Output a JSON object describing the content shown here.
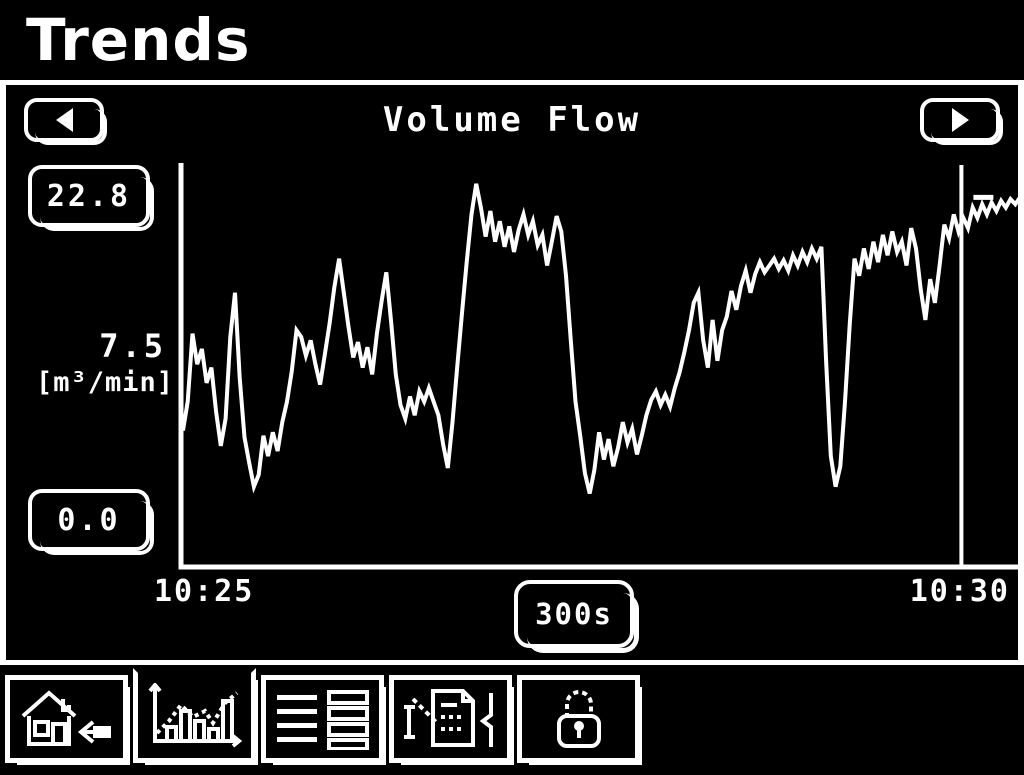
{
  "header": {
    "title": "Trends"
  },
  "chart_panel": {
    "title": "Volume Flow",
    "prev_button": "prev-channel",
    "next_button": "next-channel",
    "scale_max": "22.8",
    "scale_min": "0.0",
    "current_value": "7.5",
    "unit": "[m³/min]",
    "time_start": "10:25",
    "time_end": "10:30",
    "timespan": "300s"
  },
  "toolbar": {
    "items": [
      {
        "name": "home-button",
        "icon": "house-back-icon",
        "active": false
      },
      {
        "name": "trends-button",
        "icon": "trend-chart-icon",
        "active": true
      },
      {
        "name": "parameters-button",
        "icon": "list-rows-icon",
        "active": false
      },
      {
        "name": "report-button",
        "icon": "document-edit-icon",
        "active": false
      },
      {
        "name": "lock-button",
        "icon": "padlock-icon",
        "active": false
      }
    ]
  },
  "colors": {
    "background": "#000000",
    "foreground": "#ffffff"
  },
  "chart_data": {
    "type": "line",
    "title": "Volume Flow",
    "xlabel": "",
    "ylabel": "[m³/min]",
    "ylim": [
      0.0,
      22.8
    ],
    "xlim": [
      "10:25",
      "10:30"
    ],
    "grid": false,
    "legend": false,
    "axis_ticks_y": [
      "22.8",
      "7.5",
      "0.0"
    ],
    "axis_ticks_x": [
      "10:25",
      "10:30"
    ],
    "cursor_x_fraction": 0.93,
    "current_value": 7.5,
    "series": [
      {
        "name": "Volume Flow",
        "color": "#ffffff",
        "values": [
          7.9,
          9.6,
          13.6,
          11.8,
          12.7,
          10.7,
          11.6,
          9.0,
          7.0,
          8.6,
          13.4,
          16.0,
          11.0,
          7.5,
          6.0,
          4.6,
          5.3,
          7.6,
          6.4,
          7.8,
          6.7,
          8.4,
          9.6,
          11.4,
          13.8,
          13.4,
          12.3,
          13.2,
          11.8,
          10.6,
          12.4,
          14.2,
          16.3,
          18.0,
          16.0,
          14.0,
          12.2,
          13.1,
          11.6,
          12.8,
          11.2,
          13.6,
          15.5,
          17.2,
          14.3,
          11.2,
          9.4,
          8.6,
          9.9,
          8.8,
          10.2,
          9.6,
          10.4,
          9.6,
          8.8,
          7.1,
          5.7,
          8.4,
          11.7,
          14.8,
          17.8,
          20.6,
          22.4,
          21.0,
          19.3,
          20.8,
          19.0,
          20.2,
          18.7,
          19.9,
          18.4,
          19.7,
          20.6,
          19.4,
          20.2,
          18.8,
          19.4,
          17.6,
          19.0,
          20.5,
          19.6,
          17.0,
          13.2,
          9.6,
          7.6,
          5.4,
          4.2,
          5.6,
          7.8,
          6.2,
          7.4,
          5.8,
          6.9,
          8.4,
          7.2,
          8.0,
          6.5,
          7.6,
          8.8,
          9.7,
          10.2,
          9.4,
          10.0,
          9.3,
          10.4,
          11.3,
          12.5,
          13.8,
          15.4,
          16.0,
          13.2,
          11.6,
          14.4,
          12.0,
          13.8,
          14.6,
          16.1,
          15.0,
          16.4,
          17.3,
          16.0,
          17.1,
          17.8,
          17.2,
          17.6,
          18.0,
          17.4,
          17.9,
          17.3,
          18.2,
          17.6,
          18.4,
          17.8,
          18.6,
          18.0,
          18.7,
          12.0,
          6.4,
          4.6,
          5.8,
          9.6,
          14.2,
          18.0,
          17.0,
          18.6,
          17.4,
          19.0,
          17.8,
          19.4,
          18.2,
          19.6,
          18.4,
          19.0,
          17.6,
          19.8,
          18.6,
          16.2,
          14.4,
          16.8,
          15.4,
          17.6,
          20.0,
          19.2,
          20.6,
          19.6,
          20.4,
          19.8,
          21.0,
          20.4,
          21.2,
          20.6,
          21.3,
          20.8,
          21.4,
          21.0,
          21.5,
          21.2,
          21.6
        ]
      }
    ]
  }
}
